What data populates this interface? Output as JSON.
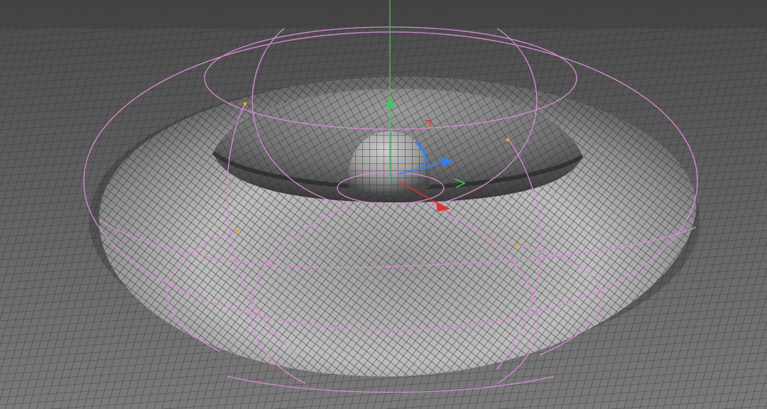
{
  "viewport": {
    "description_free": true,
    "colors": {
      "background_far": "#4a4a4a",
      "background_near": "#777777",
      "grid_line": "#2b2b2b",
      "surface_light": "#b5b5b5",
      "surface_dark": "#2e2e2e",
      "deformer_cage": "#d98ad9",
      "cage_point": "#f0a030",
      "axis_x": "#e03030",
      "axis_y": "#30d060",
      "axis_z": "#3080ff"
    },
    "icons": {
      "gizmo": "move-gizmo-icon",
      "axis_x": "arrow-x-icon",
      "axis_y": "arrow-y-icon",
      "axis_z": "arrow-z-icon"
    }
  }
}
